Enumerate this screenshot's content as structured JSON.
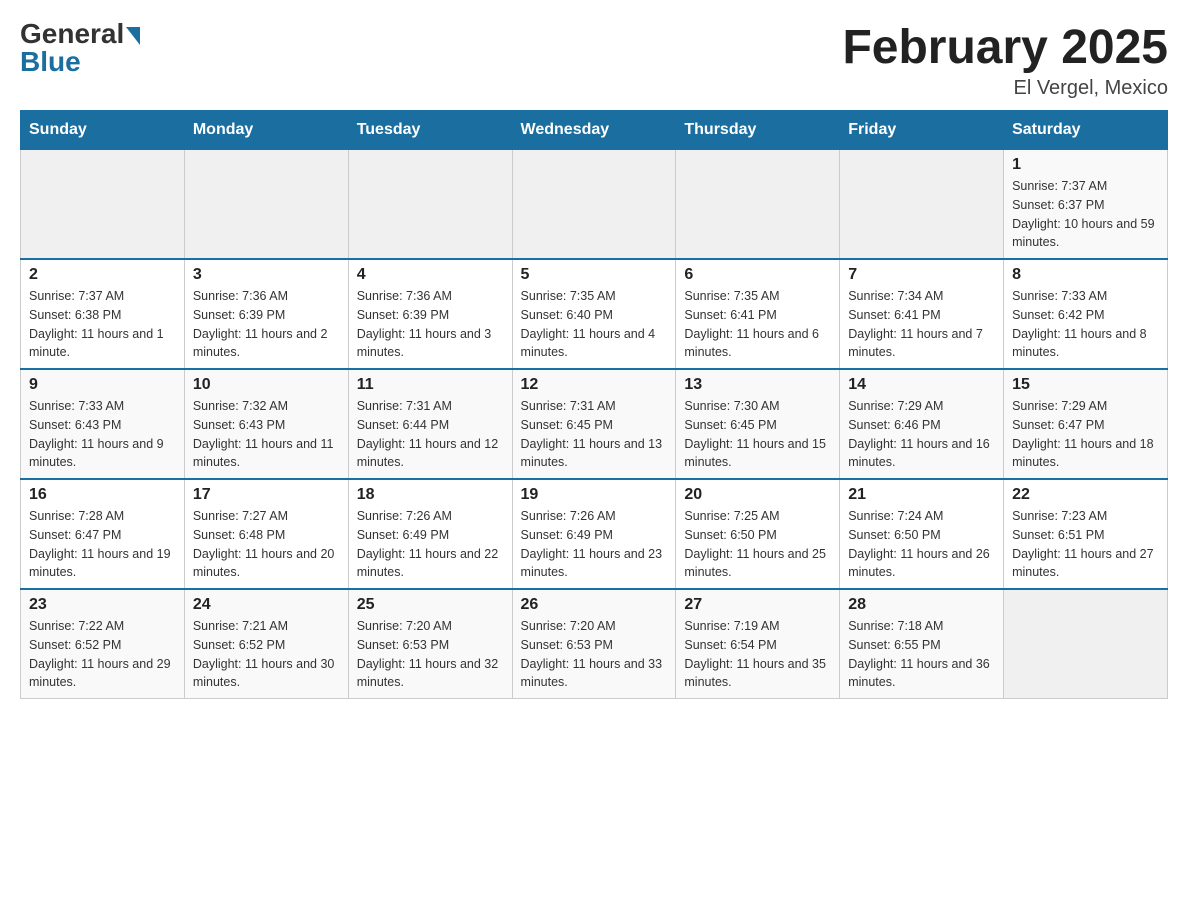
{
  "logo": {
    "general": "General",
    "blue": "Blue"
  },
  "title": "February 2025",
  "location": "El Vergel, Mexico",
  "days_header": [
    "Sunday",
    "Monday",
    "Tuesday",
    "Wednesday",
    "Thursday",
    "Friday",
    "Saturday"
  ],
  "weeks": [
    [
      {
        "day": "",
        "info": ""
      },
      {
        "day": "",
        "info": ""
      },
      {
        "day": "",
        "info": ""
      },
      {
        "day": "",
        "info": ""
      },
      {
        "day": "",
        "info": ""
      },
      {
        "day": "",
        "info": ""
      },
      {
        "day": "1",
        "info": "Sunrise: 7:37 AM\nSunset: 6:37 PM\nDaylight: 10 hours and 59 minutes."
      }
    ],
    [
      {
        "day": "2",
        "info": "Sunrise: 7:37 AM\nSunset: 6:38 PM\nDaylight: 11 hours and 1 minute."
      },
      {
        "day": "3",
        "info": "Sunrise: 7:36 AM\nSunset: 6:39 PM\nDaylight: 11 hours and 2 minutes."
      },
      {
        "day": "4",
        "info": "Sunrise: 7:36 AM\nSunset: 6:39 PM\nDaylight: 11 hours and 3 minutes."
      },
      {
        "day": "5",
        "info": "Sunrise: 7:35 AM\nSunset: 6:40 PM\nDaylight: 11 hours and 4 minutes."
      },
      {
        "day": "6",
        "info": "Sunrise: 7:35 AM\nSunset: 6:41 PM\nDaylight: 11 hours and 6 minutes."
      },
      {
        "day": "7",
        "info": "Sunrise: 7:34 AM\nSunset: 6:41 PM\nDaylight: 11 hours and 7 minutes."
      },
      {
        "day": "8",
        "info": "Sunrise: 7:33 AM\nSunset: 6:42 PM\nDaylight: 11 hours and 8 minutes."
      }
    ],
    [
      {
        "day": "9",
        "info": "Sunrise: 7:33 AM\nSunset: 6:43 PM\nDaylight: 11 hours and 9 minutes."
      },
      {
        "day": "10",
        "info": "Sunrise: 7:32 AM\nSunset: 6:43 PM\nDaylight: 11 hours and 11 minutes."
      },
      {
        "day": "11",
        "info": "Sunrise: 7:31 AM\nSunset: 6:44 PM\nDaylight: 11 hours and 12 minutes."
      },
      {
        "day": "12",
        "info": "Sunrise: 7:31 AM\nSunset: 6:45 PM\nDaylight: 11 hours and 13 minutes."
      },
      {
        "day": "13",
        "info": "Sunrise: 7:30 AM\nSunset: 6:45 PM\nDaylight: 11 hours and 15 minutes."
      },
      {
        "day": "14",
        "info": "Sunrise: 7:29 AM\nSunset: 6:46 PM\nDaylight: 11 hours and 16 minutes."
      },
      {
        "day": "15",
        "info": "Sunrise: 7:29 AM\nSunset: 6:47 PM\nDaylight: 11 hours and 18 minutes."
      }
    ],
    [
      {
        "day": "16",
        "info": "Sunrise: 7:28 AM\nSunset: 6:47 PM\nDaylight: 11 hours and 19 minutes."
      },
      {
        "day": "17",
        "info": "Sunrise: 7:27 AM\nSunset: 6:48 PM\nDaylight: 11 hours and 20 minutes."
      },
      {
        "day": "18",
        "info": "Sunrise: 7:26 AM\nSunset: 6:49 PM\nDaylight: 11 hours and 22 minutes."
      },
      {
        "day": "19",
        "info": "Sunrise: 7:26 AM\nSunset: 6:49 PM\nDaylight: 11 hours and 23 minutes."
      },
      {
        "day": "20",
        "info": "Sunrise: 7:25 AM\nSunset: 6:50 PM\nDaylight: 11 hours and 25 minutes."
      },
      {
        "day": "21",
        "info": "Sunrise: 7:24 AM\nSunset: 6:50 PM\nDaylight: 11 hours and 26 minutes."
      },
      {
        "day": "22",
        "info": "Sunrise: 7:23 AM\nSunset: 6:51 PM\nDaylight: 11 hours and 27 minutes."
      }
    ],
    [
      {
        "day": "23",
        "info": "Sunrise: 7:22 AM\nSunset: 6:52 PM\nDaylight: 11 hours and 29 minutes."
      },
      {
        "day": "24",
        "info": "Sunrise: 7:21 AM\nSunset: 6:52 PM\nDaylight: 11 hours and 30 minutes."
      },
      {
        "day": "25",
        "info": "Sunrise: 7:20 AM\nSunset: 6:53 PM\nDaylight: 11 hours and 32 minutes."
      },
      {
        "day": "26",
        "info": "Sunrise: 7:20 AM\nSunset: 6:53 PM\nDaylight: 11 hours and 33 minutes."
      },
      {
        "day": "27",
        "info": "Sunrise: 7:19 AM\nSunset: 6:54 PM\nDaylight: 11 hours and 35 minutes."
      },
      {
        "day": "28",
        "info": "Sunrise: 7:18 AM\nSunset: 6:55 PM\nDaylight: 11 hours and 36 minutes."
      },
      {
        "day": "",
        "info": ""
      }
    ]
  ]
}
